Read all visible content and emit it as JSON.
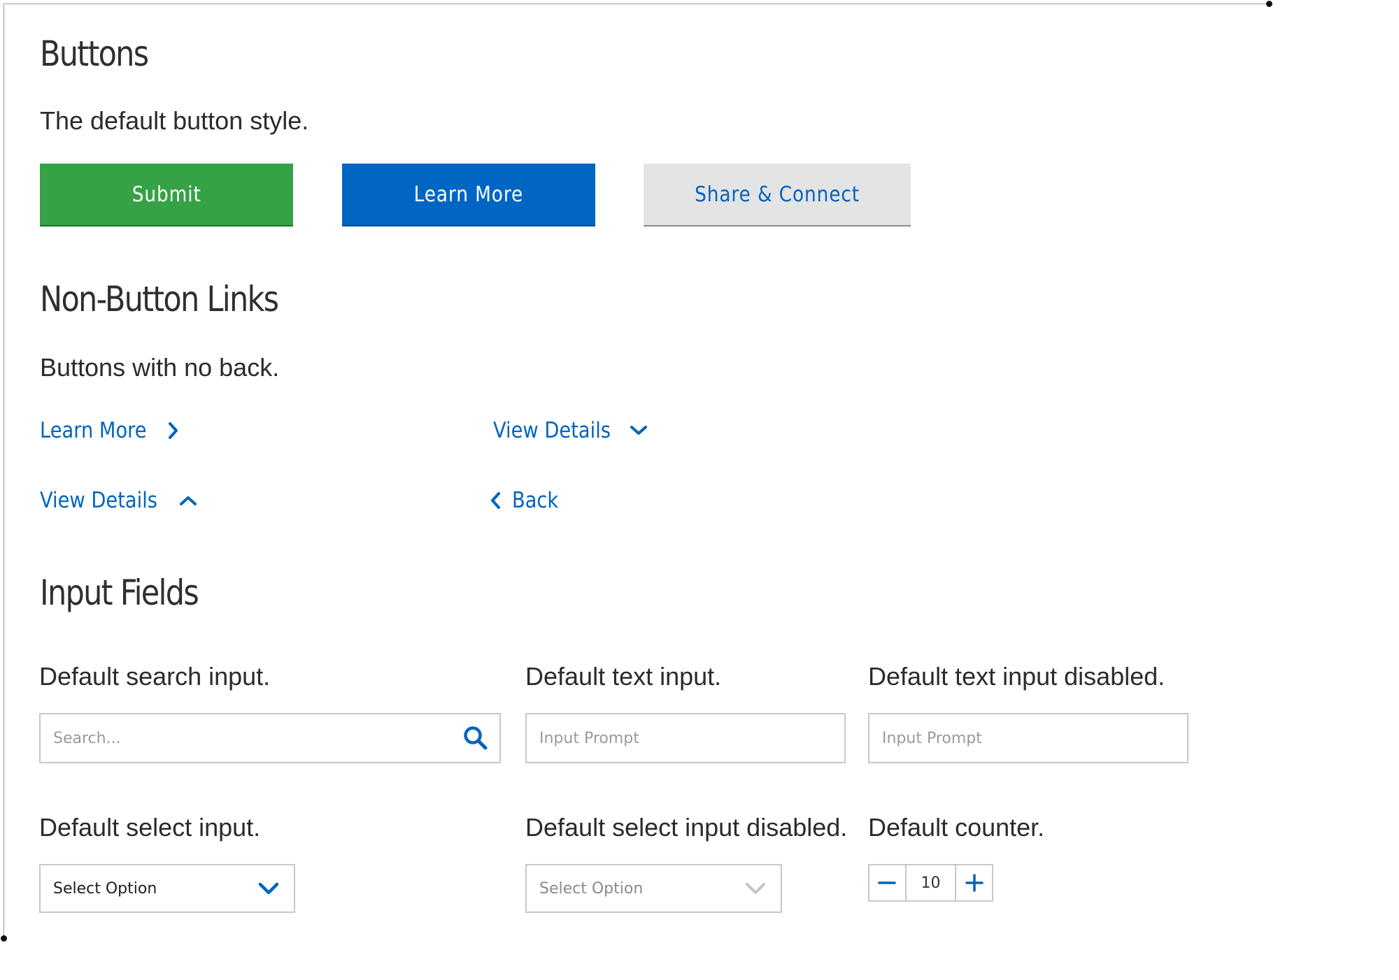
{
  "buttons_section": {
    "heading": "Buttons",
    "description": "The default button style.",
    "submit_label": "Submit",
    "learn_more_label": "Learn More",
    "share_label": "Share & Connect"
  },
  "links_section": {
    "heading": "Non-Button Links",
    "description": "Buttons with no back.",
    "learn_more_label": "Learn More",
    "view_details_down_label": "View Details",
    "view_details_up_label": "View Details",
    "back_label": "Back"
  },
  "inputs_section": {
    "heading": "Input Fields",
    "search_label": "Default search input.",
    "search_placeholder": "Search...",
    "text_label": "Default text input.",
    "text_placeholder": "Input Prompt",
    "text_disabled_label": "Default text input disabled.",
    "text_disabled_placeholder": "Input Prompt",
    "select_label": "Default select input.",
    "select_value": "Select Option",
    "select_disabled_label": "Default select input disabled.",
    "select_disabled_value": "Select Option",
    "counter_label": "Default counter.",
    "counter_value": "10"
  },
  "colors": {
    "primary_blue": "#0066c4",
    "success_green": "#35a245",
    "neutral_gray": "#e4e4e4",
    "link_blue": "#0064c0"
  },
  "icons": {
    "search": "search-icon",
    "chevron_right": "chevron-right-icon",
    "chevron_down": "chevron-down-icon",
    "chevron_up": "chevron-up-icon",
    "chevron_left": "chevron-left-icon",
    "minus": "minus-icon",
    "plus": "plus-icon"
  }
}
